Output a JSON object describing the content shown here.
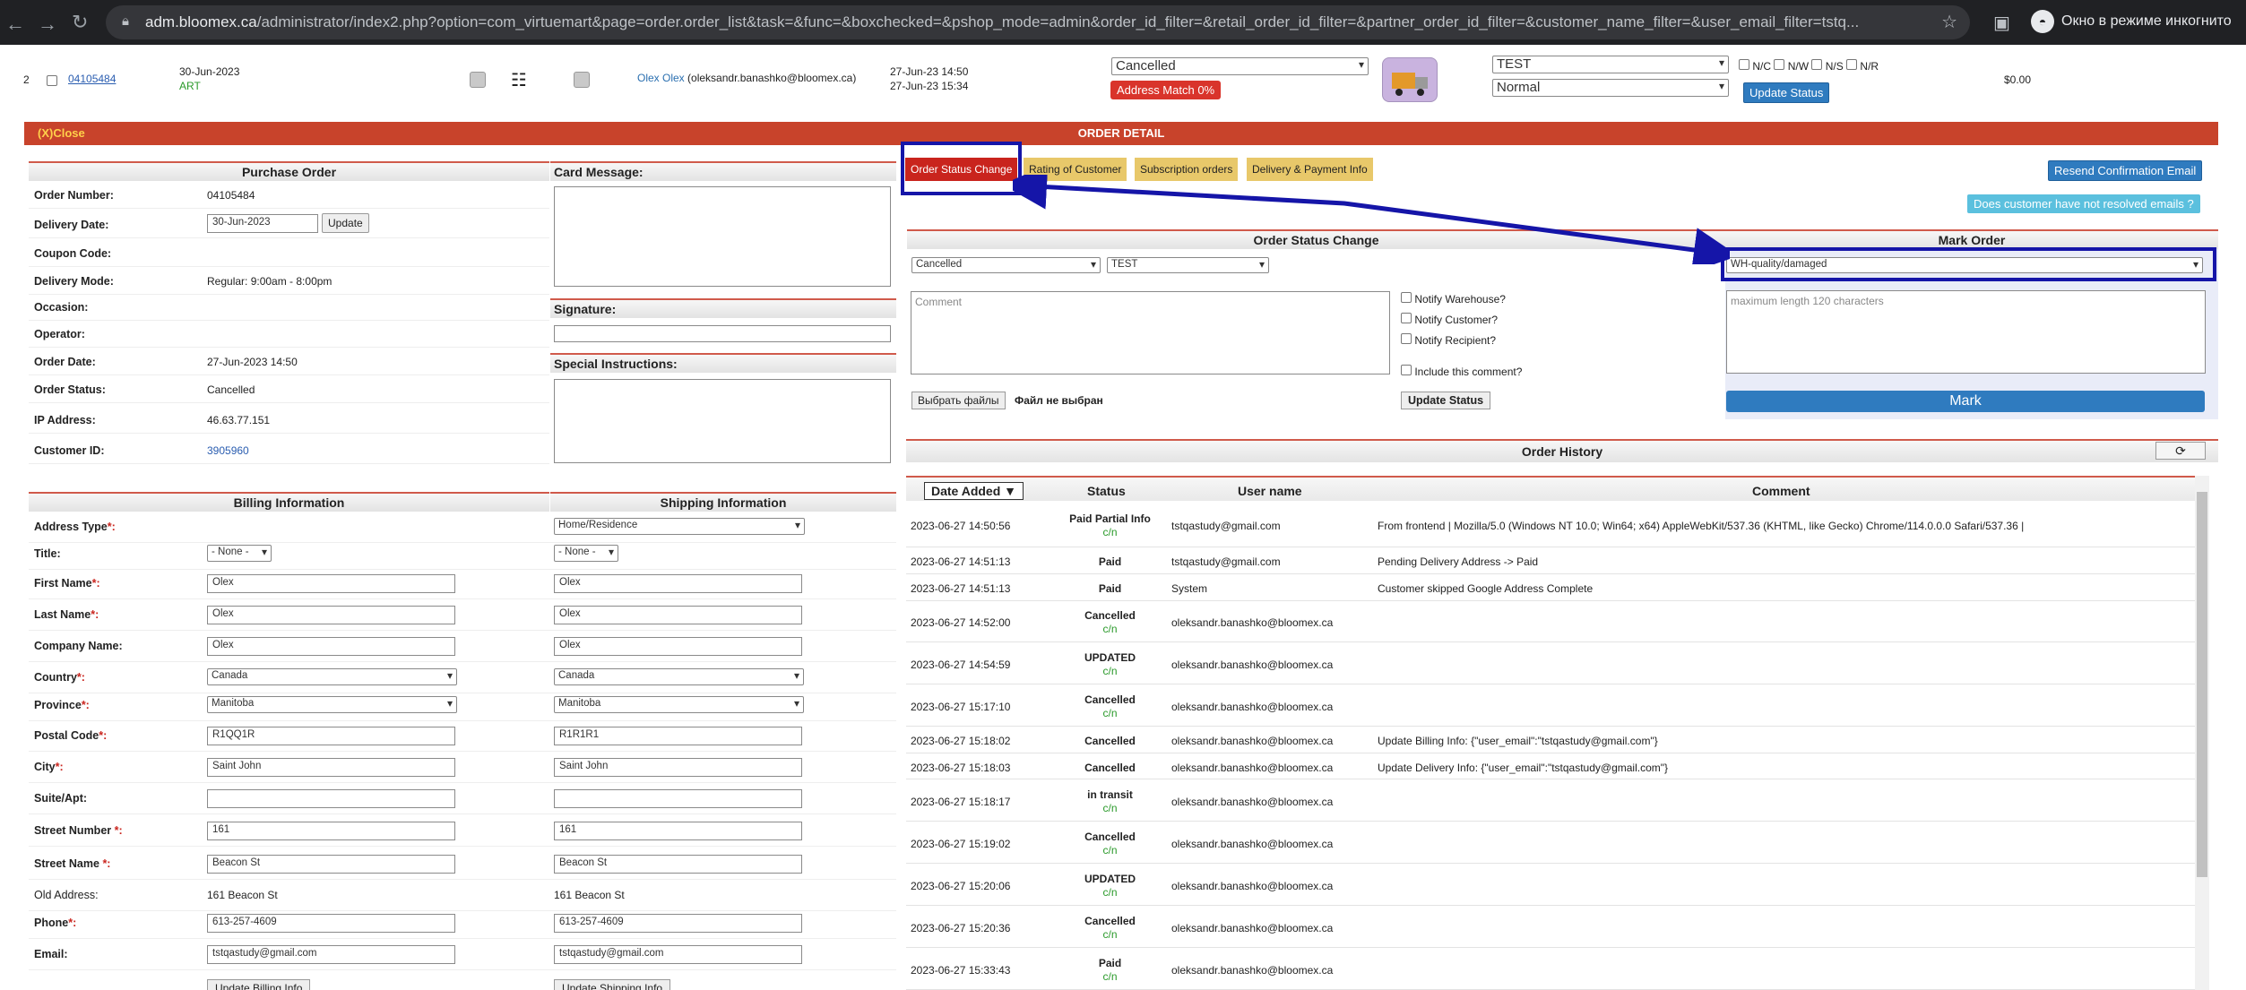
{
  "browser": {
    "url_host": "adm.bloomex.ca",
    "url_path": "/administrator/index2.php?option=com_virtuemart&page=order.order_list&task=&func=&boxchecked=&pshop_mode=admin&order_id_filter=&retail_order_id_filter=&partner_order_id_filter=&customer_name_filter=&user_email_filter=tstq...",
    "incognito_label": "Окно в режиме инкогнито"
  },
  "order_row": {
    "index": "2",
    "order_number": "04105484",
    "date": "30-Jun-2023",
    "tag": "ART",
    "customer_name": "Olex Olex",
    "customer_email": "(oleksandr.banashko@bloomex.ca)",
    "created": "27-Jun-23 14:50",
    "modified": "27-Jun-23 15:34",
    "status": "Cancelled",
    "address_match": "Address Match 0%",
    "test_select": "TEST",
    "priority_select": "Normal",
    "flags": [
      "N/C",
      "N/W",
      "N/S",
      "N/R"
    ],
    "update_status_label": "Update Status",
    "total": "$0.00"
  },
  "order_detail": {
    "close_label": "(X)Close",
    "title": "ORDER DETAIL"
  },
  "purchase_order": {
    "heading": "Purchase Order",
    "rows": [
      {
        "label": "Order Number:",
        "value": "04105484"
      },
      {
        "label": "Delivery Date:",
        "value": "30-Jun-2023"
      },
      {
        "label": "Coupon Code:",
        "value": ""
      },
      {
        "label": "Delivery Mode:",
        "value": "Regular: 9:00am - 8:00pm"
      },
      {
        "label": "Occasion:",
        "value": ""
      },
      {
        "label": "Operator:",
        "value": ""
      },
      {
        "label": "Order Date:",
        "value": "27-Jun-2023 14:50"
      },
      {
        "label": "Order Status:",
        "value": "Cancelled"
      },
      {
        "label": "IP Address:",
        "value": "46.63.77.151"
      },
      {
        "label": "Customer ID:",
        "value": "3905960"
      }
    ],
    "update_label": "Update"
  },
  "card": {
    "card_message": "Card Message:",
    "signature": "Signature:",
    "special_instructions": "Special Instructions:"
  },
  "tabs": [
    "Order Status Change",
    "Rating of Customer",
    "Subscription orders",
    "Delivery & Payment Info"
  ],
  "right_buttons": {
    "resend": "Resend Confirmation Email",
    "unresolved": "Does customer have not resolved emails ?"
  },
  "status_change": {
    "heading": "Order Status Change",
    "status": "Cancelled",
    "test": "TEST",
    "comment_placeholder": "Comment",
    "notify": [
      "Notify Warehouse?",
      "Notify Customer?",
      "Notify Recipient?"
    ],
    "include_comment": "Include this comment?",
    "choose_files": "Выбрать файлы",
    "no_file": "Файл не выбран",
    "update_status": "Update Status"
  },
  "mark_order": {
    "heading": "Mark Order",
    "selected": "WH-quality/damaged",
    "placeholder": "maximum length 120 characters",
    "mark_label": "Mark"
  },
  "history": {
    "heading": "Order History",
    "columns": [
      "Date Added ▼",
      "Status",
      "User name",
      "Comment"
    ],
    "rows": [
      {
        "date": "2023-06-27 14:50:56",
        "status": "Paid Partial Info",
        "cn": "c/n",
        "user": "tstqastudy@gmail.com",
        "comment": "From frontend | Mozilla/5.0 (Windows NT 10.0; Win64; x64) AppleWebKit/537.36 (KHTML, like Gecko) Chrome/114.0.0.0 Safari/537.36 |"
      },
      {
        "date": "2023-06-27 14:51:13",
        "status": "Paid",
        "cn": "",
        "user": "tstqastudy@gmail.com",
        "comment": "Pending Delivery Address -> Paid"
      },
      {
        "date": "2023-06-27 14:51:13",
        "status": "Paid",
        "cn": "",
        "user": "System",
        "comment": "Customer skipped Google Address Complete"
      },
      {
        "date": "2023-06-27 14:52:00",
        "status": "Cancelled",
        "cn": "c/n",
        "user": "oleksandr.banashko@bloomex.ca",
        "comment": ""
      },
      {
        "date": "2023-06-27 14:54:59",
        "status": "UPDATED",
        "cn": "c/n",
        "user": "oleksandr.banashko@bloomex.ca",
        "comment": ""
      },
      {
        "date": "2023-06-27 15:17:10",
        "status": "Cancelled",
        "cn": "c/n",
        "user": "oleksandr.banashko@bloomex.ca",
        "comment": ""
      },
      {
        "date": "2023-06-27 15:18:02",
        "status": "Cancelled",
        "cn": "",
        "user": "oleksandr.banashko@bloomex.ca",
        "comment": "Update Billing Info: {\"user_email\":\"tstqastudy@gmail.com\"}"
      },
      {
        "date": "2023-06-27 15:18:03",
        "status": "Cancelled",
        "cn": "",
        "user": "oleksandr.banashko@bloomex.ca",
        "comment": "Update Delivery Info: {\"user_email\":\"tstqastudy@gmail.com\"}"
      },
      {
        "date": "2023-06-27 15:18:17",
        "status": "in transit",
        "cn": "c/n",
        "user": "oleksandr.banashko@bloomex.ca",
        "comment": ""
      },
      {
        "date": "2023-06-27 15:19:02",
        "status": "Cancelled",
        "cn": "c/n",
        "user": "oleksandr.banashko@bloomex.ca",
        "comment": ""
      },
      {
        "date": "2023-06-27 15:20:06",
        "status": "UPDATED",
        "cn": "c/n",
        "user": "oleksandr.banashko@bloomex.ca",
        "comment": ""
      },
      {
        "date": "2023-06-27 15:20:36",
        "status": "Cancelled",
        "cn": "c/n",
        "user": "oleksandr.banashko@bloomex.ca",
        "comment": ""
      },
      {
        "date": "2023-06-27 15:33:43",
        "status": "Paid",
        "cn": "c/n",
        "user": "oleksandr.banashko@bloomex.ca",
        "comment": ""
      }
    ]
  },
  "billing": {
    "heading": "Billing Information",
    "shipping_heading": "Shipping Information",
    "rows": [
      {
        "label": "Address Type",
        "req": "*:",
        "bill": "",
        "ship": "Home/Residence",
        "kind": "select-ship"
      },
      {
        "label": "Title:",
        "req": "",
        "bill": "- None -",
        "ship": "- None -",
        "kind": "small-select"
      },
      {
        "label": "First Name",
        "req": "*:",
        "bill": "Olex",
        "ship": "Olex",
        "kind": "input"
      },
      {
        "label": "Last Name",
        "req": "*:",
        "bill": "Olex",
        "ship": "Olex",
        "kind": "input"
      },
      {
        "label": "Company Name:",
        "req": "",
        "bill": "Olex",
        "ship": "Olex",
        "kind": "input"
      },
      {
        "label": "Country",
        "req": "*:",
        "bill": "Canada",
        "ship": "Canada",
        "kind": "select"
      },
      {
        "label": "Province",
        "req": "*:",
        "bill": "Manitoba",
        "ship": "Manitoba",
        "kind": "select"
      },
      {
        "label": "Postal Code",
        "req": "*:",
        "bill": "R1QQ1R",
        "ship": "R1R1R1",
        "kind": "input"
      },
      {
        "label": "City",
        "req": "*:",
        "bill": "Saint John",
        "ship": "Saint John",
        "kind": "input"
      },
      {
        "label": "Suite/Apt:",
        "req": "",
        "bill": "",
        "ship": "",
        "kind": "input"
      },
      {
        "label": "Street Number ",
        "req": "*:",
        "bill": "161",
        "ship": "161",
        "kind": "input"
      },
      {
        "label": "Street Name ",
        "req": "*:",
        "bill": "Beacon St",
        "ship": "Beacon St",
        "kind": "input"
      },
      {
        "label": "Old Address:",
        "req": "",
        "bill": "161 Beacon St",
        "ship": "161 Beacon St",
        "kind": "text"
      },
      {
        "label": "Phone",
        "req": "*:",
        "bill": "613-257-4609",
        "ship": "613-257-4609",
        "kind": "input"
      },
      {
        "label": "Email:",
        "req": "",
        "bill": "tstqastudy@gmail.com",
        "ship": "tstqastudy@gmail.com",
        "kind": "input"
      }
    ],
    "update_billing": "Update Billing Info",
    "update_shipping": "Update Shipping Info"
  },
  "colors": {
    "annotation": "#1515a8",
    "header_red": "#c8432b",
    "button_blue": "#2f7bbf"
  }
}
